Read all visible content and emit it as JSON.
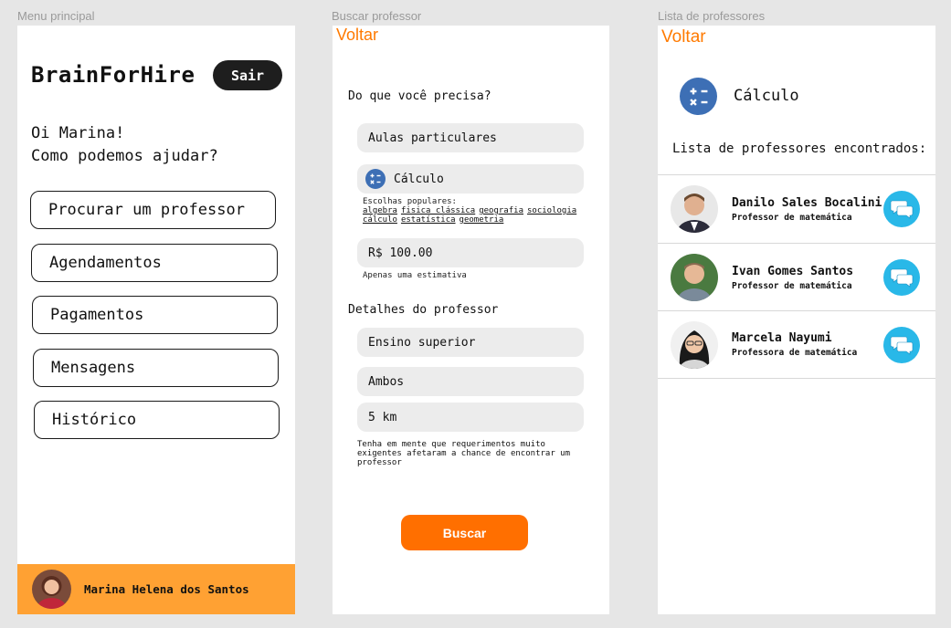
{
  "frames": {
    "menu_label": "Menu principal",
    "search_label": "Buscar professor",
    "list_label": "Lista de professores"
  },
  "menu": {
    "brand": "BrainForHire",
    "logout": "Sair",
    "greeting_line1": "Oi Marina!",
    "greeting_line2": "Como podemos ajudar?",
    "items": [
      {
        "label": "Procurar um professor"
      },
      {
        "label": "Agendamentos"
      },
      {
        "label": "Pagamentos"
      },
      {
        "label": "Mensagens"
      },
      {
        "label": "Histórico"
      }
    ],
    "user_name": "Marina Helena dos Santos"
  },
  "search": {
    "back": "Voltar",
    "question": "Do que você precisa?",
    "service": "Aulas particulares",
    "subject": "Cálculo",
    "popular_title": "Escolhas populares:",
    "popular_row1": [
      "algebra",
      "fisica clássica",
      "geografia",
      "sociologia"
    ],
    "popular_row2": [
      "cálculo",
      "estatística",
      "geometria"
    ],
    "price": "R$ 100.00",
    "price_note": "Apenas uma estimativa",
    "details_title": "Detalhes do professor",
    "education": "Ensino superior",
    "mode": "Ambos",
    "distance": "5 km",
    "warning": "Tenha em mente que requerimentos muito exigentes afetaram a chance de encontrar um professor",
    "search_button": "Buscar"
  },
  "list": {
    "back": "Voltar",
    "subject": "Cálculo",
    "title": "Lista de professores encontrados:",
    "teachers": [
      {
        "name": "Danilo Sales Bocalini",
        "role": "Professor de matemática"
      },
      {
        "name": "Ivan Gomes Santos",
        "role": "Professor de matemática"
      },
      {
        "name": "Marcela Nayumi",
        "role": "Professora de matemática"
      }
    ]
  },
  "colors": {
    "accent_orange": "#ff6f00",
    "profile_bar": "#ffa133",
    "calc_icon": "#3d6fb5",
    "chat_icon": "#29b8e8"
  },
  "icons": [
    "calculator-icon",
    "chat-icon",
    "avatar"
  ]
}
